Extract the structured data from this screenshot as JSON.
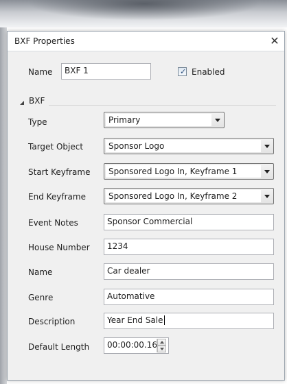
{
  "window": {
    "title": "BXF Properties",
    "close_glyph": "✕"
  },
  "header": {
    "name_label": "Name",
    "name_value": "BXF 1",
    "enabled_label": "Enabled",
    "enabled_checked": true
  },
  "section": {
    "title": "BXF"
  },
  "fields": {
    "type": {
      "label": "Type",
      "value": "Primary"
    },
    "target_object": {
      "label": "Target Object",
      "value": "Sponsor Logo"
    },
    "start_keyframe": {
      "label": "Start Keyframe",
      "value": "Sponsored Logo In, Keyframe 1"
    },
    "end_keyframe": {
      "label": "End Keyframe",
      "value": "Sponsored Logo In, Keyframe 2"
    },
    "event_notes": {
      "label": "Event Notes",
      "value": "Sponsor Commercial"
    },
    "house_number": {
      "label": "House Number",
      "value": "1234"
    },
    "name": {
      "label": "Name",
      "value": "Car dealer"
    },
    "genre": {
      "label": "Genre",
      "value": "Automative"
    },
    "description": {
      "label": "Description",
      "value": "Year End Sale"
    },
    "default_length": {
      "label": "Default Length",
      "value": "00:00:00.16"
    }
  }
}
